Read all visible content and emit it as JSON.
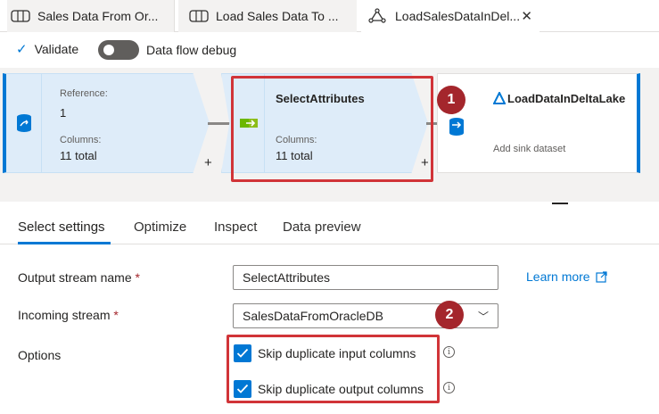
{
  "tabs": [
    {
      "label": "Sales Data From Or...",
      "icon": "dataset-icon"
    },
    {
      "label": "Load Sales Data To ...",
      "icon": "dataset-icon"
    },
    {
      "label": "LoadSalesDataInDel...",
      "icon": "dataflow-icon",
      "active": true
    }
  ],
  "toolbar": {
    "validate_label": "Validate",
    "debug_label": "Data flow debug",
    "debug_on": false
  },
  "canvas": {
    "source": {
      "reference_label": "Reference:",
      "reference_value": "1",
      "columns_label": "Columns:",
      "columns_value": "11 total"
    },
    "select": {
      "title": "SelectAttributes",
      "columns_label": "Columns:",
      "columns_value": "11 total"
    },
    "sink": {
      "title": "LoadDataInDeltaLake",
      "subtitle": "Add sink dataset"
    },
    "plus": "+"
  },
  "callouts": {
    "first": "1",
    "second": "2",
    "color": "#d13438"
  },
  "settings_tabs": [
    "Select settings",
    "Optimize",
    "Inspect",
    "Data preview"
  ],
  "form": {
    "output_stream_label": "Output stream name",
    "output_stream_value": "SelectAttributes",
    "incoming_stream_label": "Incoming stream",
    "incoming_stream_value": "SalesDataFromOracleDB",
    "required_mark": "*",
    "learn_more": "Learn more",
    "options_label": "Options",
    "skip_input_label": "Skip duplicate input columns",
    "skip_input_checked": true,
    "skip_output_label": "Skip duplicate output columns",
    "skip_output_checked": true,
    "info_glyph": "i"
  },
  "colors": {
    "accent": "#0078d4",
    "node_fill": "#deecf9",
    "callout_badge": "#a4262c"
  }
}
